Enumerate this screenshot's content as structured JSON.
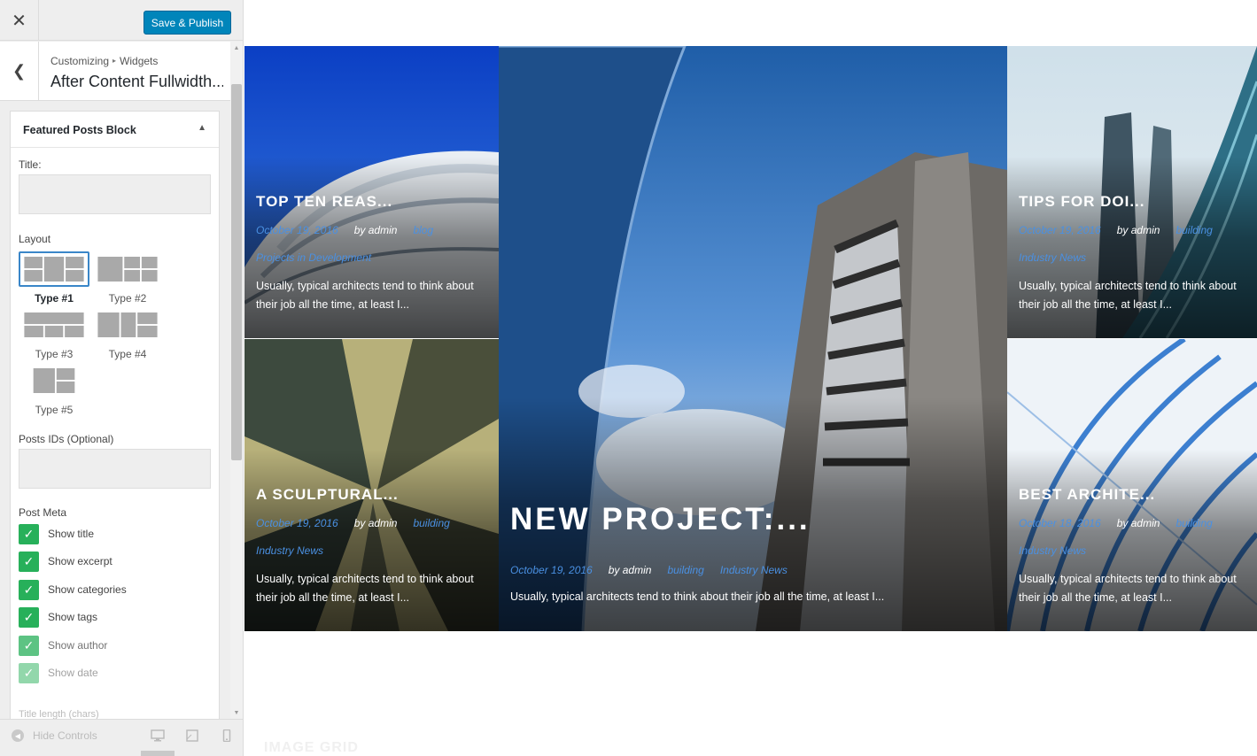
{
  "sidebar": {
    "close_icon": "close-icon",
    "publish_label": "Save & Publish",
    "breadcrumb": {
      "root": "Customizing",
      "separator": "▸",
      "current": "Widgets"
    },
    "section_title": "After Content Fullwidth...",
    "widget": {
      "title": "Featured Posts Block",
      "title_field_label": "Title:",
      "title_value": "",
      "layout_label": "Layout",
      "layouts": [
        {
          "label": "Type #1",
          "selected": true
        },
        {
          "label": "Type #2",
          "selected": false
        },
        {
          "label": "Type #3",
          "selected": false
        },
        {
          "label": "Type #4",
          "selected": false
        },
        {
          "label": "Type #5",
          "selected": false
        }
      ],
      "posts_ids_label": "Posts IDs (Optional)",
      "posts_ids_value": "",
      "post_meta_label": "Post Meta",
      "checks": [
        {
          "label": "Show title",
          "checked": true
        },
        {
          "label": "Show excerpt",
          "checked": true
        },
        {
          "label": "Show categories",
          "checked": true
        },
        {
          "label": "Show tags",
          "checked": true
        },
        {
          "label": "Show author",
          "checked": true
        },
        {
          "label": "Show date",
          "checked": true
        }
      ],
      "next_field_label": "Title length (chars)"
    },
    "footer": {
      "hide_controls": "Hide Controls"
    }
  },
  "preview": {
    "posts": [
      {
        "title": "TOP TEN REAS...",
        "date": "October 19, 2016",
        "author": "by admin",
        "category": "blog",
        "tag": "Projects in Development",
        "excerpt_line1": "Usually, typical architects tend to think about",
        "excerpt_line2": "their job all the time, at least I..."
      },
      {
        "title": "A SCULPTURAL...",
        "date": "October 19, 2016",
        "author": "by admin",
        "category": "building",
        "tag": "Industry News",
        "excerpt_line1": "Usually, typical architects tend to think about",
        "excerpt_line2": "their job all the time, at least I..."
      },
      {
        "title": "NEW PROJECT:...",
        "date": "October 19, 2016",
        "author": "by admin",
        "category": "building",
        "tag": "Industry News",
        "excerpt_line1": "Usually, typical architects tend to think about their job all the time, at least I..."
      },
      {
        "title": "TIPS FOR DOI...",
        "date": "October 19, 2016",
        "author": "by admin",
        "category": "building",
        "tag": "Industry News",
        "excerpt_line1": "Usually, typical architects tend to think about",
        "excerpt_line2": "their job all the time, at least I..."
      },
      {
        "title": "BEST ARCHITE...",
        "date": "October 18, 2016",
        "author": "by admin",
        "category": "building",
        "tag": "Industry News",
        "excerpt_line1": "Usually, typical architects tend to think about",
        "excerpt_line2": "their job all the time, at least I..."
      }
    ],
    "next_section_label": "IMAGE GRID"
  },
  "colors": {
    "accent": "#0085ba",
    "check": "#27b05a",
    "link": "#4a90e2"
  }
}
